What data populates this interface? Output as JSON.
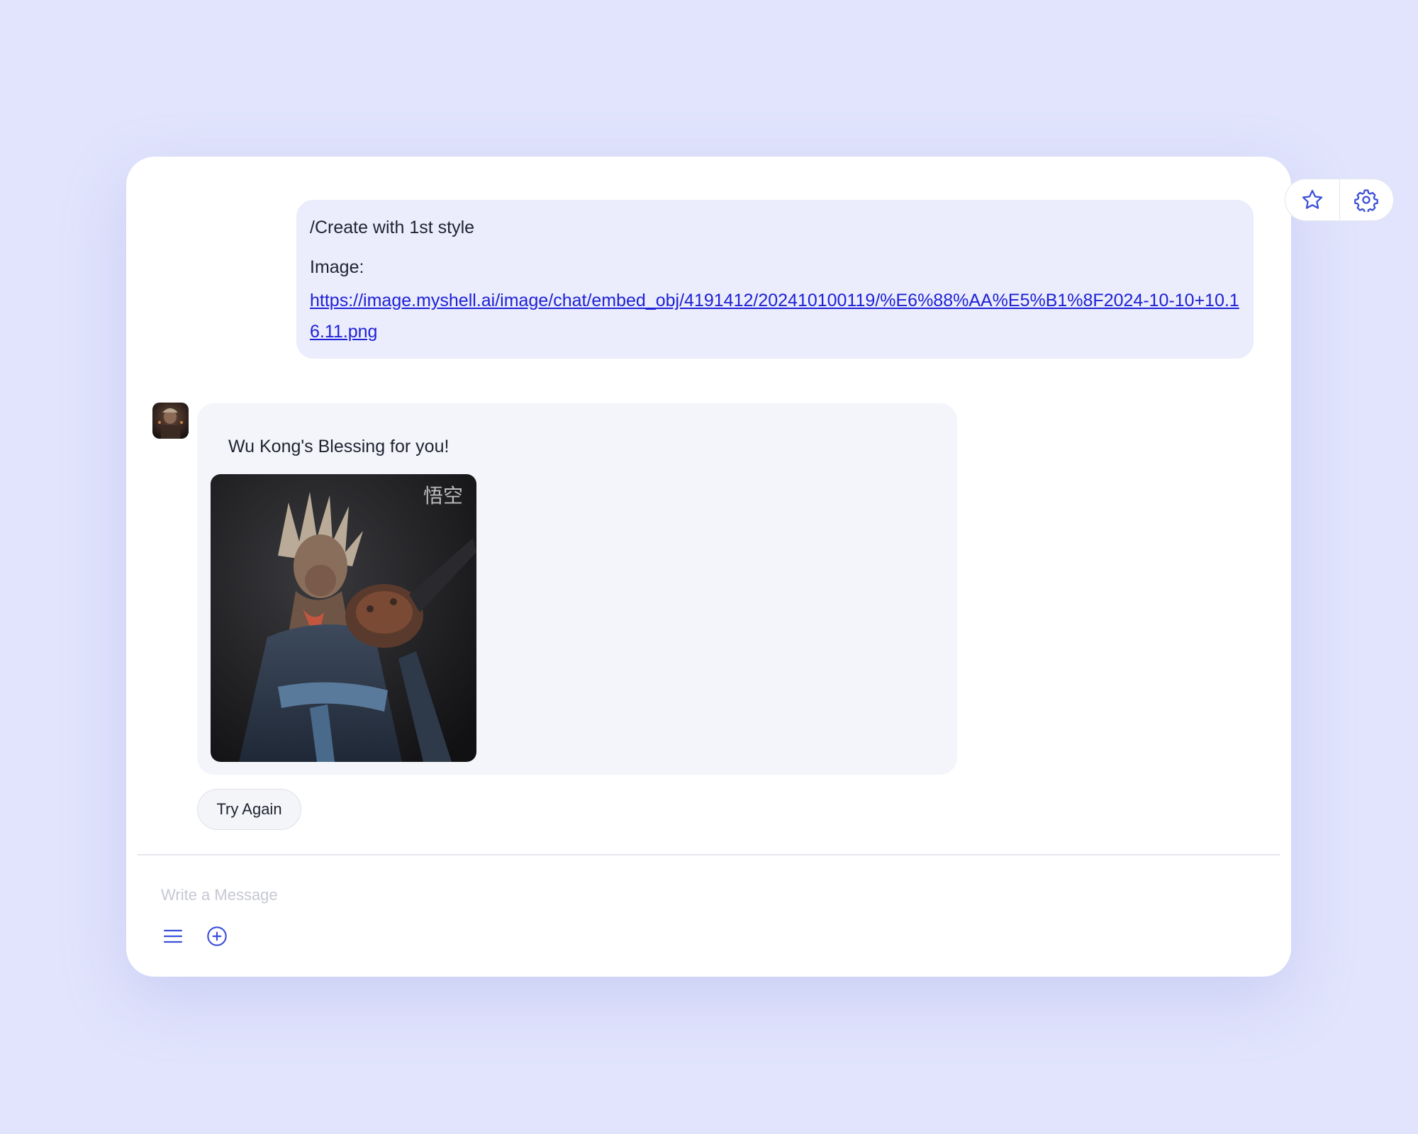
{
  "colors": {
    "page_background": "#e1e4fc",
    "accent": "#3a4fd8",
    "link": "#1d21d6",
    "user_bubble": "#ebecfc",
    "bot_bubble": "#f4f5fa"
  },
  "top_actions": {
    "favorite_icon": "star-icon",
    "settings_icon": "gear-icon"
  },
  "user_message": {
    "command": "/Create with 1st style",
    "image_label": "Image:",
    "image_url": "https://image.myshell.ai/image/chat/embed_obj/4191412/202410100119/%E6%88%AA%E5%B1%8F2024-10-10+10.16.11.png"
  },
  "bot_message": {
    "text": "Wu Kong's Blessing for you!",
    "image_icon": "wukong-portrait-image"
  },
  "actions": {
    "try_again": "Try Again"
  },
  "composer": {
    "placeholder": "Write a Message",
    "menu_icon": "menu-icon",
    "add_icon": "plus-circle-icon"
  }
}
